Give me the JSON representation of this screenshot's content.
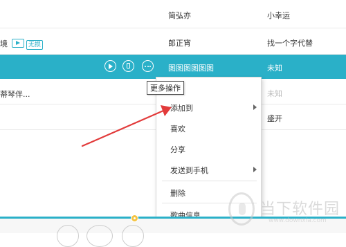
{
  "songs": [
    {
      "title": "",
      "artist": "简弘亦",
      "album": "小幸运"
    },
    {
      "title": "境",
      "tag_mv": "mv-icon",
      "tag_quality": "无损",
      "artist": "郎正宵",
      "album": "找一个字代替"
    },
    {
      "title": "",
      "artist": "图图图图图图",
      "album": "未知"
    },
    {
      "title": "蒂琴伴...",
      "artist": "",
      "album": "未知"
    },
    {
      "title": "",
      "artist": "",
      "album": "盛开"
    }
  ],
  "row_actions": {
    "play": "play-circle-icon",
    "to_phone": "phone-icon",
    "more": "more-dots-icon"
  },
  "tooltip": "更多操作",
  "context_menu": {
    "items": [
      {
        "label": "添加到",
        "has_submenu": true
      },
      {
        "label": "喜欢",
        "has_submenu": false
      },
      {
        "label": "分享",
        "has_submenu": false
      },
      {
        "label": "发送到手机",
        "has_submenu": true
      },
      {
        "label": "删除",
        "has_submenu": false
      },
      {
        "label": "歌曲信息",
        "has_submenu": false
      }
    ]
  },
  "watermark": {
    "text": "当下软件园",
    "url": "www.downxia.com"
  },
  "colors": {
    "accent": "#2ab0c8",
    "arrow": "#e23b3b",
    "progress_knob": "#f4c341"
  }
}
